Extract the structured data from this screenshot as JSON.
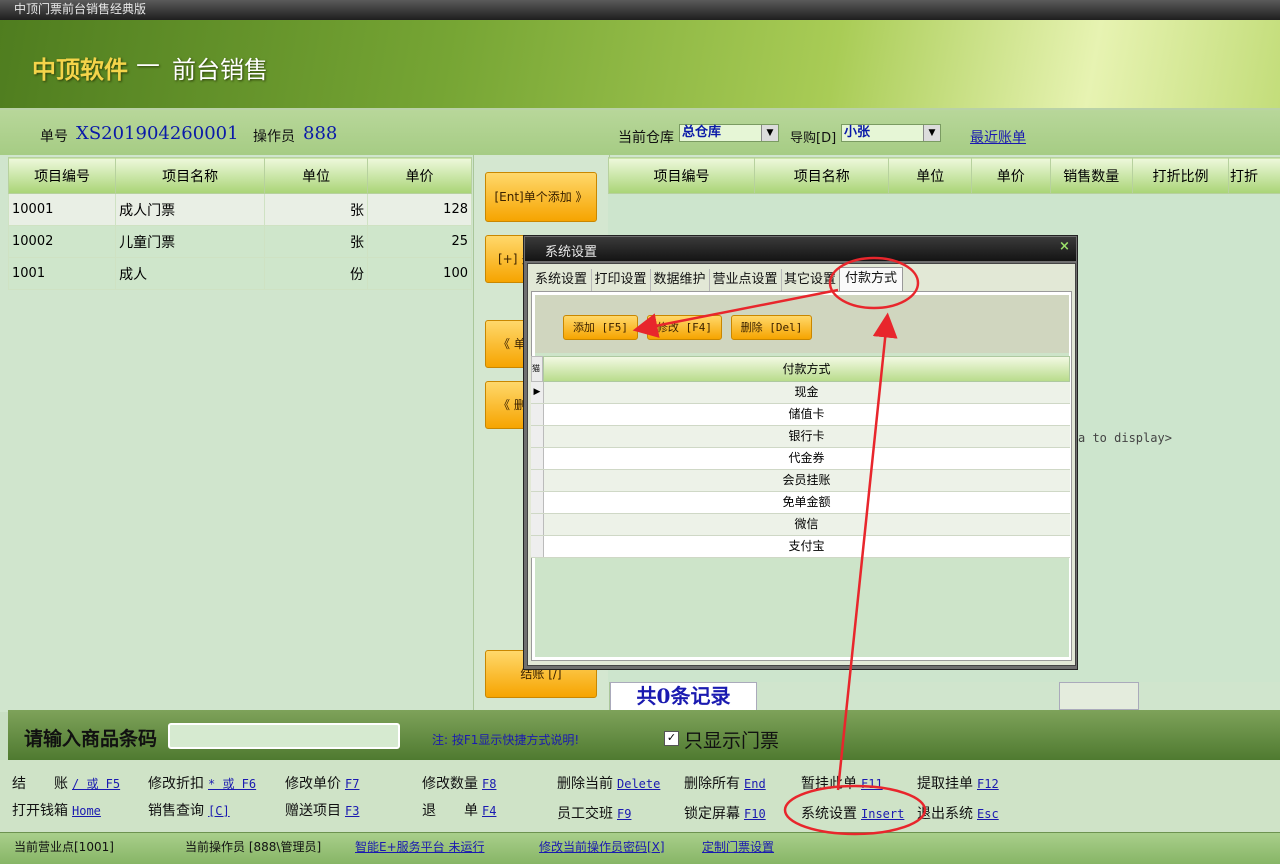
{
  "window": {
    "title": "中顶门票前台销售经典版"
  },
  "brand": {
    "name": "中顶软件",
    "separator": "—",
    "subtitle": "前台销售"
  },
  "info": {
    "order_label": "单号",
    "order_no": "XS201904260001",
    "operator_label": "操作员",
    "operator_no": "888",
    "warehouse_label": "当前仓库",
    "warehouse_value": "总仓库",
    "guide_label": "导购[D]",
    "guide_value": "小张",
    "recent_bills": "最近账单"
  },
  "left_table": {
    "headers": [
      "项目编号",
      "项目名称",
      "单位",
      "单价"
    ],
    "rows": [
      [
        "10001",
        "成人门票",
        "张",
        "128"
      ],
      [
        "10002",
        "儿童门票",
        "张",
        "25"
      ],
      [
        "1001",
        "成人",
        "份",
        "100"
      ]
    ]
  },
  "mid_buttons": {
    "add_single": "[Ent]单个添加 》",
    "add_multi": "[+] 多",
    "delete_single": "《 单",
    "delete_all": "《 删",
    "checkout": "结账 [/]"
  },
  "right_table": {
    "headers": [
      "项目编号",
      "项目名称",
      "单位",
      "单价",
      "销售数量",
      "打折比例",
      "打折"
    ],
    "no_data": "a to display>",
    "record_count": "共0条记录"
  },
  "barcode": {
    "label": "请输入商品条码",
    "hint": "注: 按F1显示快捷方式说明!",
    "only_tickets_label": "只显示门票",
    "only_tickets_checked": true
  },
  "shortcuts": [
    {
      "label": "结　　账",
      "key": "/ 或 F5"
    },
    {
      "label": "修改折扣",
      "key": "* 或 F6"
    },
    {
      "label": "修改单价",
      "key": "F7"
    },
    {
      "label": "修改数量",
      "key": "F8"
    },
    {
      "label": "删除当前",
      "key": "Delete"
    },
    {
      "label": "删除所有",
      "key": "End"
    },
    {
      "label": "暂挂此单",
      "key": "F11"
    },
    {
      "label": "提取挂单",
      "key": "F12"
    },
    {
      "label": "打开钱箱",
      "key": "Home"
    },
    {
      "label": "销售查询",
      "key": "[C]"
    },
    {
      "label": "赠送项目",
      "key": "F3"
    },
    {
      "label": "退　　单",
      "key": "F4"
    },
    {
      "label": "员工交班",
      "key": "F9"
    },
    {
      "label": "锁定屏幕",
      "key": "F10"
    },
    {
      "label": "系统设置",
      "key": "Insert"
    },
    {
      "label": "退出系统",
      "key": "Esc"
    }
  ],
  "status": {
    "business_point": "当前营业点[1001]",
    "operator": "当前操作员 [888\\管理员]",
    "platform": "智能E+服务平台 未运行",
    "change_pwd": "修改当前操作员密码[X]",
    "ticket_settings": "定制门票设置"
  },
  "dialog": {
    "title": "系统设置",
    "close": "×",
    "tabs": [
      "系统设置",
      "打印设置",
      "数据维护",
      "营业点设置",
      "其它设置",
      "付款方式"
    ],
    "active_tab": "付款方式",
    "buttons": {
      "add": "添加 [F5]",
      "edit": "修改 [F4]",
      "delete": "删除 [Del]"
    },
    "column_header": "付款方式",
    "corner_mark": "猫",
    "payment_methods": [
      "现金",
      "储值卡",
      "银行卡",
      "代金券",
      "会员挂账",
      "免单金额",
      "微信",
      "支付宝"
    ]
  },
  "annotation_color": "#e8262c"
}
